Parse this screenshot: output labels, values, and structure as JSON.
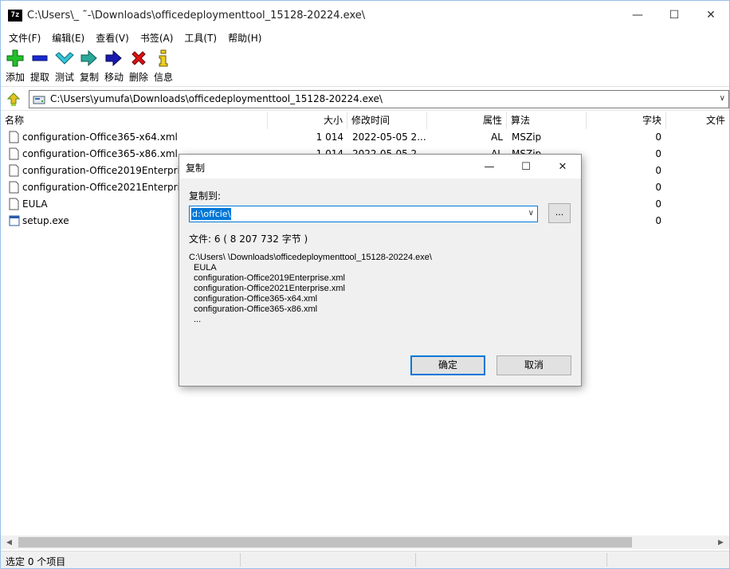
{
  "window": {
    "title": "C:\\Users\\_        ˜-\\Downloads\\officedeploymenttool_15128-20224.exe\\",
    "app_icon_text": "7z"
  },
  "menu": [
    "文件(F)",
    "编辑(E)",
    "查看(V)",
    "书签(A)",
    "工具(T)",
    "帮助(H)"
  ],
  "toolbar": [
    {
      "label": "添加",
      "icon": "add-icon"
    },
    {
      "label": "提取",
      "icon": "extract-icon"
    },
    {
      "label": "测试",
      "icon": "test-icon"
    },
    {
      "label": "复制",
      "icon": "copy-icon"
    },
    {
      "label": "移动",
      "icon": "move-icon"
    },
    {
      "label": "删除",
      "icon": "delete-icon"
    },
    {
      "label": "信息",
      "icon": "info-icon"
    }
  ],
  "address": {
    "path": "C:\\Users\\yumufa\\Downloads\\officedeploymenttool_15128-20224.exe\\"
  },
  "columns": {
    "name": "名称",
    "size": "大小",
    "modified": "修改时间",
    "attrs": "属性",
    "method": "算法",
    "blocks": "字块",
    "folders": "文件"
  },
  "rows": [
    {
      "name": "configuration-Office365-x64.xml",
      "size": "1 014",
      "modified": "2022-05-05 2...",
      "attrs": "AL",
      "method": "MSZip",
      "blocks": "0"
    },
    {
      "name": "configuration-Office365-x86.xml",
      "size": "1 014",
      "modified": "2022-05-05 2...",
      "attrs": "AL",
      "method": "MSZip",
      "blocks": "0"
    },
    {
      "name": "configuration-Office2019Enterprise",
      "size": "",
      "modified": "",
      "attrs": "",
      "method": "",
      "blocks": "0"
    },
    {
      "name": "configuration-Office2021Enterprise",
      "size": "",
      "modified": "",
      "attrs": "",
      "method": "",
      "blocks": "0"
    },
    {
      "name": "EULA",
      "size": "",
      "modified": "",
      "attrs": "",
      "method": "",
      "blocks": "0"
    },
    {
      "name": "setup.exe",
      "size": "",
      "modified": "",
      "attrs": "",
      "method": "",
      "blocks": "0"
    }
  ],
  "status": {
    "text": "选定 0 个项目"
  },
  "dialog": {
    "title": "复制",
    "copy_to_label": "复制到:",
    "destination": "d:\\offcie\\",
    "browse_label": "...",
    "files_count": "文件: 6   ( 8 207 732 字节 )",
    "source_path": "C:\\Users\\        \\Downloads\\officedeploymenttool_15128-20224.exe\\",
    "items": [
      "EULA",
      "configuration-Office2019Enterprise.xml",
      "configuration-Office2021Enterprise.xml",
      "configuration-Office365-x64.xml",
      "configuration-Office365-x86.xml",
      "..."
    ],
    "ok_label": "确定",
    "cancel_label": "取消"
  }
}
